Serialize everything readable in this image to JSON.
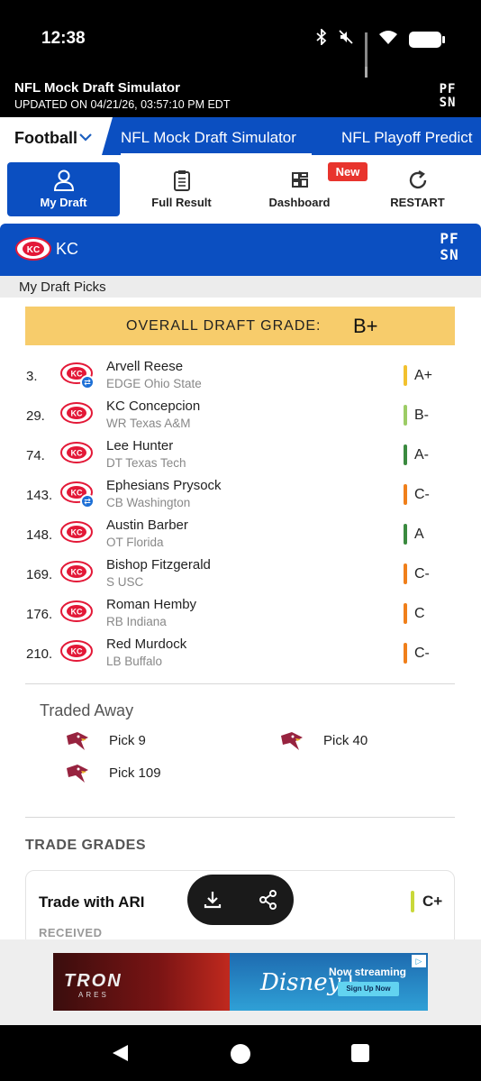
{
  "status_bar": {
    "time": "12:38"
  },
  "app_header": {
    "title": "NFL Mock Draft Simulator",
    "updated": "UPDATED ON 04/21/26, 03:57:10 PM EDT",
    "logo_top": "PF",
    "logo_bottom": "SN"
  },
  "nav": {
    "sport": "Football",
    "links": [
      "NFL Mock Draft Simulator",
      "NFL Playoff Predict"
    ]
  },
  "tabs": [
    {
      "label": "My Draft",
      "icon": "user-icon",
      "active": true
    },
    {
      "label": "Full Result",
      "icon": "clipboard-icon",
      "active": false
    },
    {
      "label": "Dashboard",
      "icon": "dashboard-icon",
      "active": false
    },
    {
      "label": "RESTART",
      "icon": "restart-icon",
      "active": false
    }
  ],
  "new_badge": "New",
  "team": {
    "abbr": "KC",
    "logo_top": "PF",
    "logo_bottom": "SN"
  },
  "section_title": "My Draft Picks",
  "grade": {
    "label": "OVERALL DRAFT GRADE:",
    "value": "B+"
  },
  "picks": [
    {
      "num": "3.",
      "name": "Arvell Reese",
      "pos": "EDGE Ohio State",
      "grade": "A+",
      "grade_color": "#f2c12e",
      "traded": true
    },
    {
      "num": "29.",
      "name": "KC Concepcion",
      "pos": "WR Texas A&M",
      "grade": "B-",
      "grade_color": "#9ccc65",
      "traded": false
    },
    {
      "num": "74.",
      "name": "Lee Hunter",
      "pos": "DT Texas Tech",
      "grade": "A-",
      "grade_color": "#3a8a3f",
      "traded": false
    },
    {
      "num": "143.",
      "name": "Ephesians Prysock",
      "pos": "CB Washington",
      "grade": "C-",
      "grade_color": "#f07f1a",
      "traded": true
    },
    {
      "num": "148.",
      "name": "Austin Barber",
      "pos": "OT Florida",
      "grade": "A",
      "grade_color": "#3a8a3f",
      "traded": false
    },
    {
      "num": "169.",
      "name": "Bishop Fitzgerald",
      "pos": "S USC",
      "grade": "C-",
      "grade_color": "#f07f1a",
      "traded": false
    },
    {
      "num": "176.",
      "name": "Roman Hemby",
      "pos": "RB Indiana",
      "grade": "C",
      "grade_color": "#f07f1a",
      "traded": false
    },
    {
      "num": "210.",
      "name": "Red Murdock",
      "pos": "LB Buffalo",
      "grade": "C-",
      "grade_color": "#f07f1a",
      "traded": false
    }
  ],
  "traded_away": {
    "title": "Traded Away",
    "items": [
      "Pick 9",
      "Pick 40",
      "Pick 109"
    ]
  },
  "trade_grades": {
    "title": "TRADE GRADES",
    "card": {
      "title": "Trade with ARI",
      "grade": "C+",
      "received_label": "RECEIVED"
    }
  },
  "ad": {
    "left_text": "TRON",
    "left_sub": "ARES",
    "right_brand": "Disney+",
    "right_text": "Now streaming",
    "cta": "Sign Up Now"
  },
  "colors": {
    "brand_blue": "#0b4fc1",
    "grade_box": "#f7cc6b",
    "chiefs_red": "#e31837",
    "cardinals_red": "#97233f"
  }
}
